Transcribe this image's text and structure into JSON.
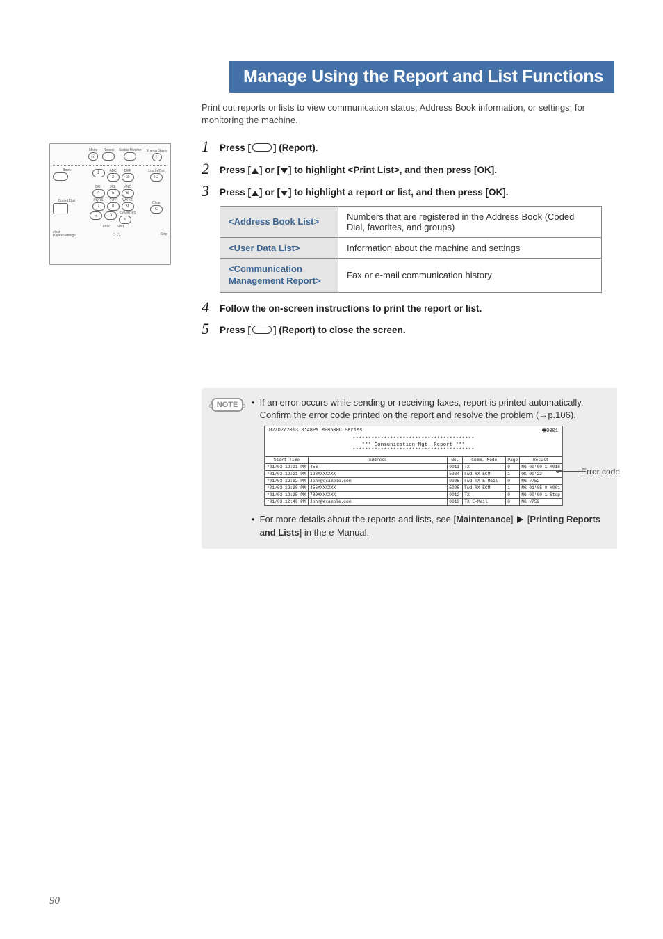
{
  "heading": "Manage Using the Report and List Functions",
  "intro": "Print out reports or lists to view communication status, Address Book information, or settings, for monitoring the machine.",
  "steps": {
    "s1": {
      "prefix": "Press [",
      "suffix": "] (Report)."
    },
    "s2": {
      "prefix": "Press [",
      "mid": "] or [",
      "suffix": "] to highlight <Print List>, and then press [OK]."
    },
    "s3": {
      "prefix": "Press [",
      "mid": "] or [",
      "suffix": "] to highlight a report or list, and then press [OK]."
    },
    "s4": "Follow the on-screen instructions to print the report or list.",
    "s5": {
      "prefix": "Press [",
      "suffix": "] (Report) to close the screen."
    }
  },
  "table": {
    "r1_h": "<Address Book List>",
    "r1_d": "Numbers that are registered in the Address Book (Coded Dial, favorites, and groups)",
    "r2_h": "<User Data List>",
    "r2_d": "Information about the machine and settings",
    "r3_h": "<Communication Management Report>",
    "r3_d": "Fax or e-mail communication history"
  },
  "note": {
    "badge": "NOTE",
    "b1": "If an error occurs while sending or receiving faxes, report is printed automatically. Confirm the error code printed on the report and resolve the problem (→p.106).",
    "b2_pre": "For more details about the reports and lists, see [",
    "b2_m1": "Maintenance",
    "b2_mid": "] ",
    "b2_mid2": " [",
    "b2_m2": "Printing Reports and Lists",
    "b2_post": "] in the e-Manual."
  },
  "error_code_label": "Error code",
  "sample": {
    "topline_l": "02/02/2013 8:48PM MF8500C Series",
    "topline_r": "🖷0001",
    "title_l1": "***************************************",
    "title_l2": "***   Communication Mgt. Report   ***",
    "title_l3": "***************************************",
    "cols": [
      "Start Time",
      "Address",
      "No.",
      "Comm. Mode",
      "Page",
      "Result"
    ],
    "rows": [
      [
        "*01/03 12:21 PM",
        "456",
        "0011",
        "TX",
        "0",
        "NG 00'00 1 #018"
      ],
      [
        "*01/03 12:21 PM",
        "123XXXXXXX",
        "5004",
        "Fwd RX     ECM",
        "1",
        "OK 00'22"
      ],
      [
        "*01/03 12:32 PM",
        "John@example.com",
        "0006",
        "Fwd TX  E-Mail",
        "0",
        "NG #752"
      ],
      [
        "*01/03 12:38 PM",
        "456XXXXXXX",
        "5006",
        "Fwd RX     ECM",
        "1",
        "NG 01'05 0 #001"
      ],
      [
        "*01/03 12:35 PM",
        "789XXXXXXX",
        "0012",
        "TX",
        "0",
        "NG 00'00 1 Stop"
      ],
      [
        "*01/03 12:49 PM",
        "John@example.com",
        "0013",
        "TX      E-Mail",
        "0",
        "NG #752"
      ]
    ]
  },
  "panel": {
    "toplabels": [
      "Menu",
      "Report",
      "Status Monitor",
      "Energy Saver"
    ],
    "book": "Book",
    "coded": "Coded Dial",
    "row_abc": [
      "",
      "ABC",
      "DEF"
    ],
    "row_ghi": [
      "GHI",
      "JKL",
      "MNO"
    ],
    "row_pqrs": [
      "PQRS",
      "TUV",
      "WXYZ"
    ],
    "row_sym": [
      "",
      "",
      "SYMBOLS"
    ],
    "tone": "Tone",
    "start": "Start",
    "login": "Log In/Out",
    "id": "ID",
    "clear": "Clear",
    "c": "C",
    "stop": "Stop",
    "select": "elect Paper/Settings"
  },
  "page_number": "90"
}
